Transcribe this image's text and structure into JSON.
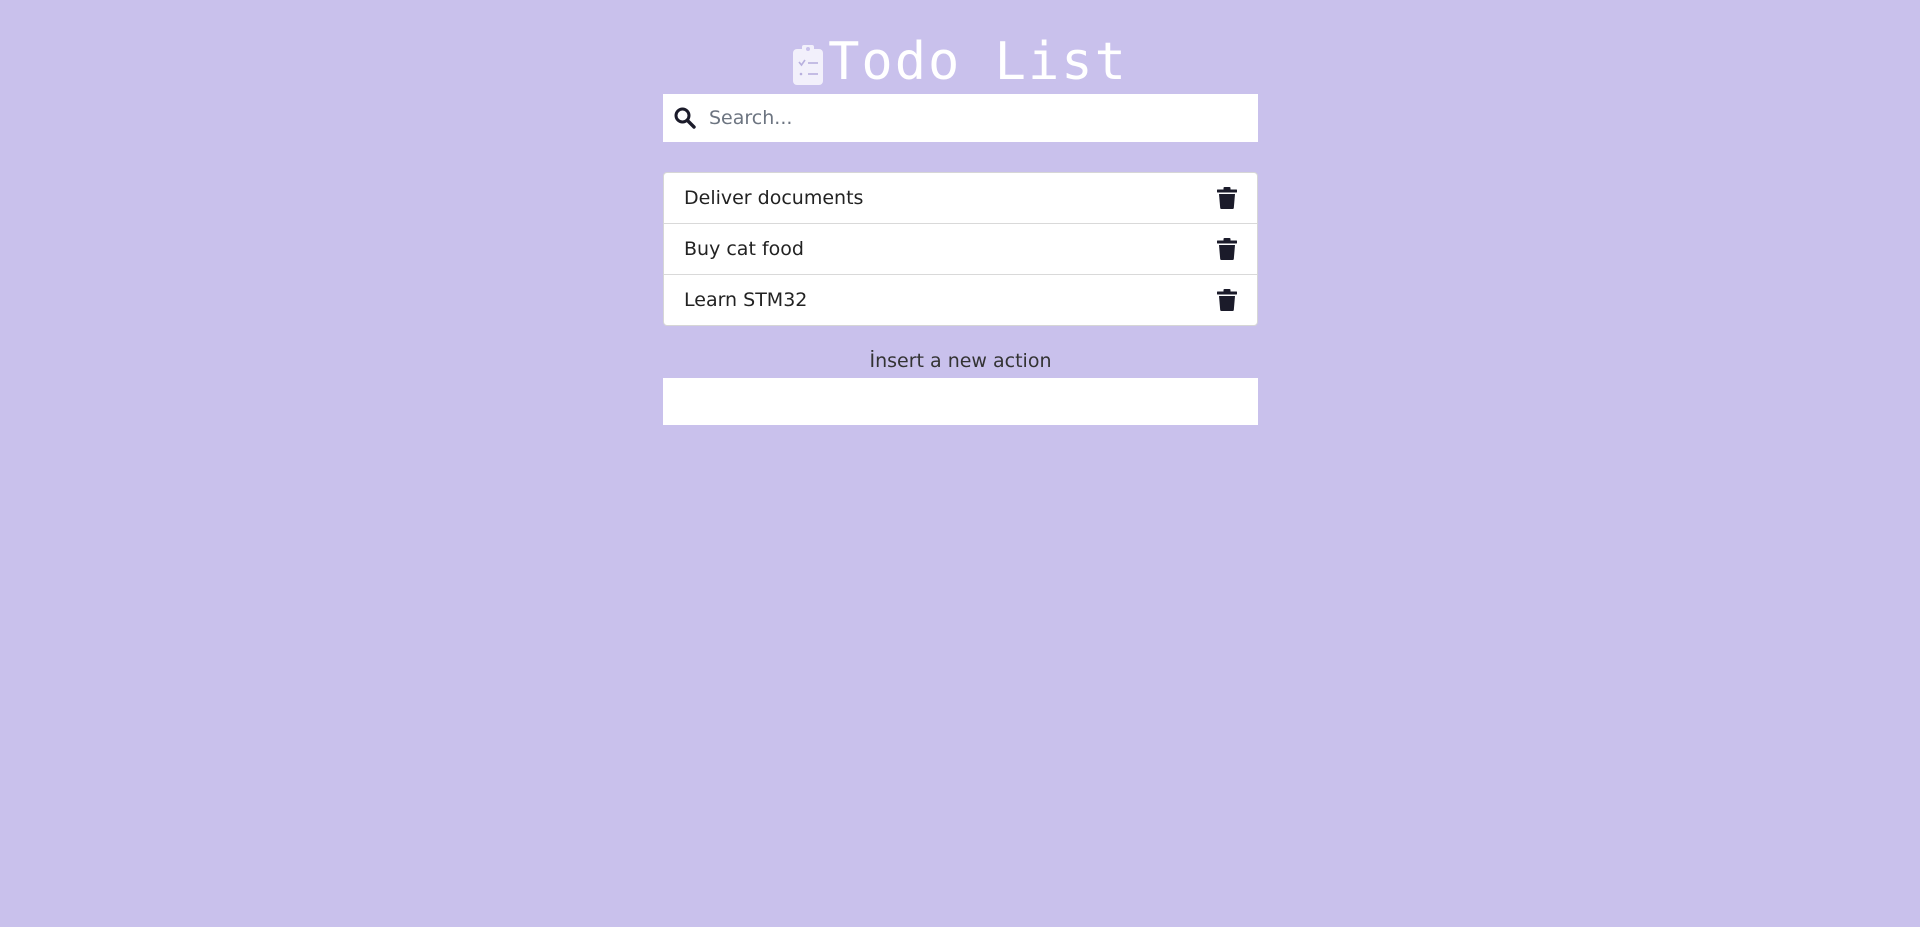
{
  "header": {
    "title": "Todo List",
    "icon": "clipboard-check-icon",
    "title_color": "#ffffff"
  },
  "search": {
    "placeholder": "Search...",
    "value": "",
    "icon": "search-icon"
  },
  "todos": {
    "items": [
      {
        "text": "Deliver documents",
        "icon": "trash-icon"
      },
      {
        "text": "Buy cat food",
        "icon": "trash-icon"
      },
      {
        "text": "Learn STM32",
        "icon": "trash-icon"
      }
    ]
  },
  "new_action": {
    "label": "İnsert a new action",
    "value": ""
  },
  "colors": {
    "background": "#c9c1ec",
    "surface": "#ffffff",
    "text": "#222222"
  }
}
